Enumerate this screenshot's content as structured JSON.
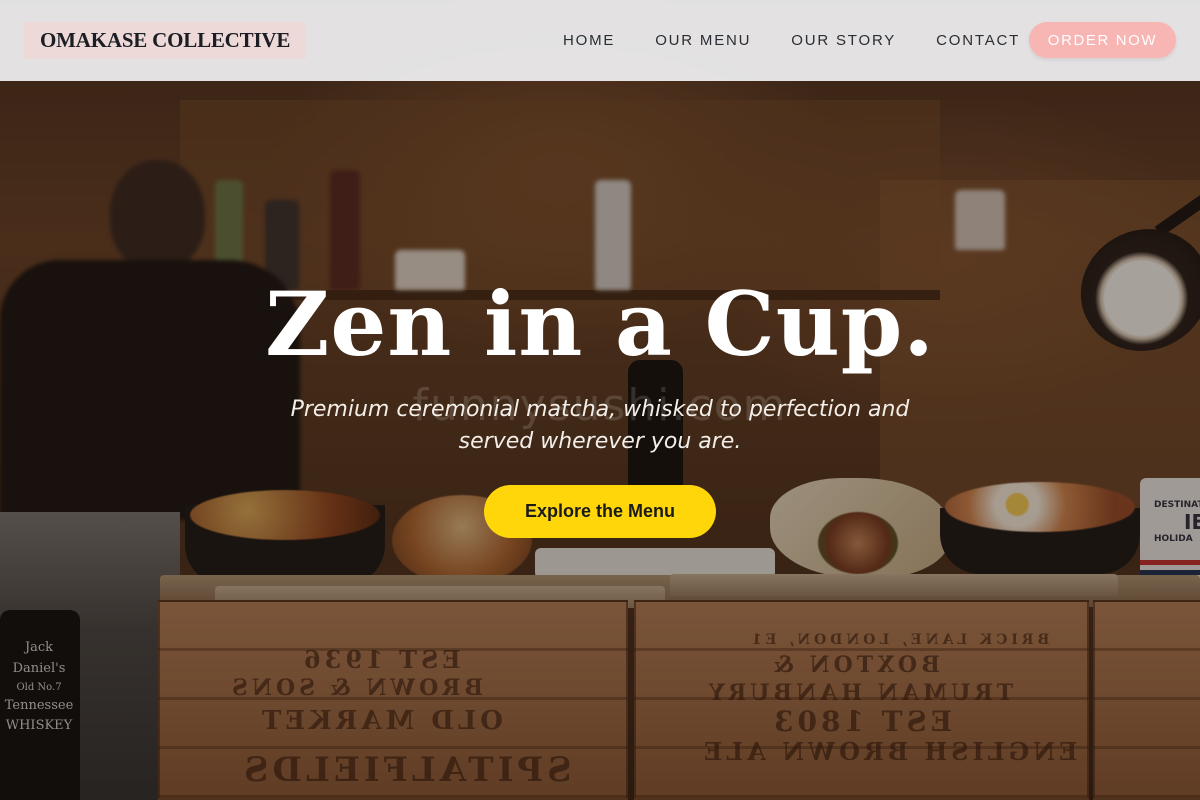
{
  "header": {
    "logo": "OMAKASE COLLECTIVE",
    "nav": [
      {
        "label": "HOME"
      },
      {
        "label": "OUR MENU"
      },
      {
        "label": "OUR STORY"
      },
      {
        "label": "CONTACT"
      }
    ],
    "order_label": "ORDER NOW"
  },
  "hero": {
    "title": "Zen in a Cup.",
    "subtitle": "Premium ceremonial matcha, whisked to perfection and served wherever you are.",
    "cta_label": "Explore the Menu",
    "watermark": "funnysushi.com"
  },
  "background": {
    "crate_left_lines": [
      "EST 1936",
      "BROWN & SONS",
      "OLD MARKET",
      "SPITALFIELDS"
    ],
    "crate_right_lines": [
      "BRICK LANE, LONDON, E1",
      "BOXTON &",
      "TRUMAN HANBURY",
      "EST 1803",
      "ENGLISH BROWN ALE"
    ],
    "bottle_label_lines": [
      "Jack Daniel's",
      "Old No.7",
      "Tennessee",
      "WHISKEY"
    ],
    "mug_lines": [
      "DESTINATI",
      "IE",
      "HOLIDA"
    ]
  },
  "colors": {
    "header_bg": "#f0f0f2",
    "order_button": "#f7b5b3",
    "cta_button": "#ffd60a",
    "title_text": "#ffffff"
  }
}
